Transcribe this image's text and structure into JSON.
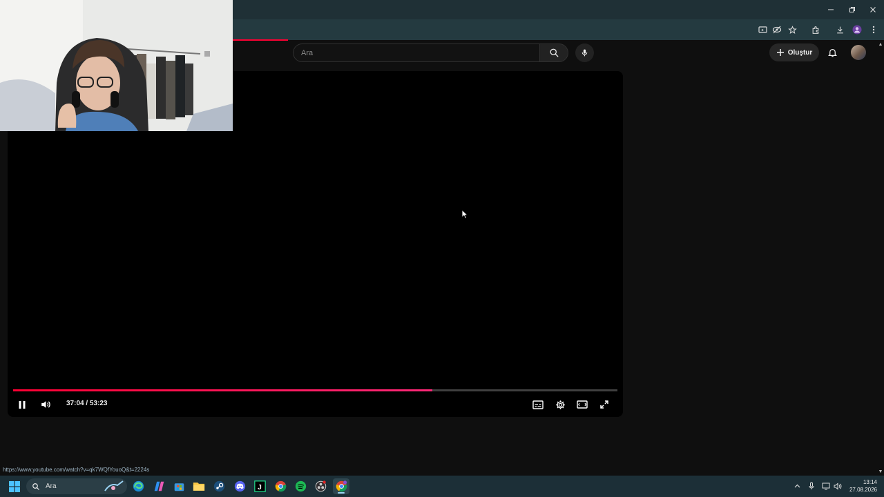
{
  "window": {
    "controls": [
      "minimize",
      "restore",
      "close"
    ]
  },
  "toolbar": {
    "icons": [
      "cast-icon",
      "eye-off-icon",
      "star-icon",
      "extensions-icon",
      "download-icon",
      "profile-icon",
      "more-icon"
    ]
  },
  "header": {
    "search_placeholder": "Ara",
    "create_label": "Oluştur"
  },
  "player": {
    "time_current": "37:04",
    "time_total": "53:23",
    "time_text": "37:04 / 53:23",
    "progress": 0.694,
    "accent": "#ff0033",
    "state": "playing"
  },
  "status_bar": {
    "url": "https://www.youtube.com/watch?v=qk7WQfYouoQ&t=2224s"
  },
  "taskbar": {
    "search_label": "Ara",
    "apps": [
      "windows-start",
      "edge",
      "copilot",
      "microsoft-store",
      "file-explorer",
      "steam",
      "discord",
      "jetbrains",
      "chrome",
      "spotify",
      "obs",
      "chrome-active"
    ],
    "clock_time": "13:14",
    "clock_date": "27.08.2026"
  },
  "colors": {
    "background": "#0f0f0f",
    "chrome": "#1f3036",
    "taskbar": "#1c2f37"
  }
}
